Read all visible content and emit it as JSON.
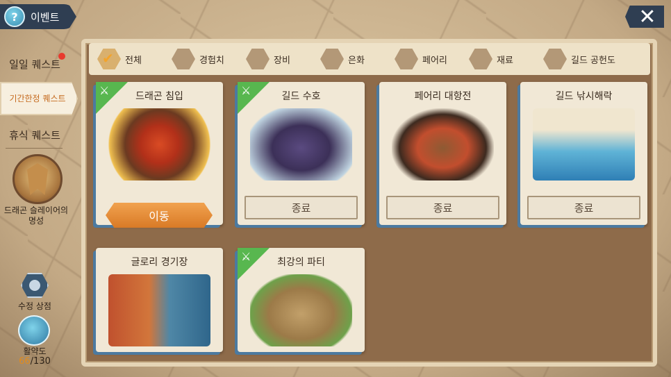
{
  "header": {
    "title": "이벤트",
    "help_icon": "question-icon",
    "close_icon": "close-icon"
  },
  "sidebar": {
    "daily": "일일 퀘스트",
    "limited": "기간한정 퀘스트",
    "rest": "휴식 퀘스트",
    "dragon_label": "드래곤 슬레이어의 명성",
    "crystal_shop": "수정 상점",
    "activity": {
      "label": "활약도",
      "current": "66",
      "max": "/130"
    }
  },
  "filters": [
    "전체",
    "경험치",
    "장비",
    "은화",
    "페어리",
    "재료",
    "길드 공헌도"
  ],
  "cards": [
    {
      "title": "드래곤 침입",
      "button": "이동",
      "state": "active"
    },
    {
      "title": "길드 수호",
      "button": "종료",
      "state": "ended"
    },
    {
      "title": "페어리 대항전",
      "button": "종료",
      "state": "ended"
    },
    {
      "title": "길드 낚시해락",
      "button": "종료",
      "state": "ended"
    },
    {
      "title": "글로리 경기장",
      "state": "none"
    },
    {
      "title": "최강의 파티",
      "state": "none"
    }
  ],
  "colors": {
    "accent_orange": "#e28b1c",
    "ribbon_green": "#58b74f",
    "header_navy": "#2f3e52"
  }
}
